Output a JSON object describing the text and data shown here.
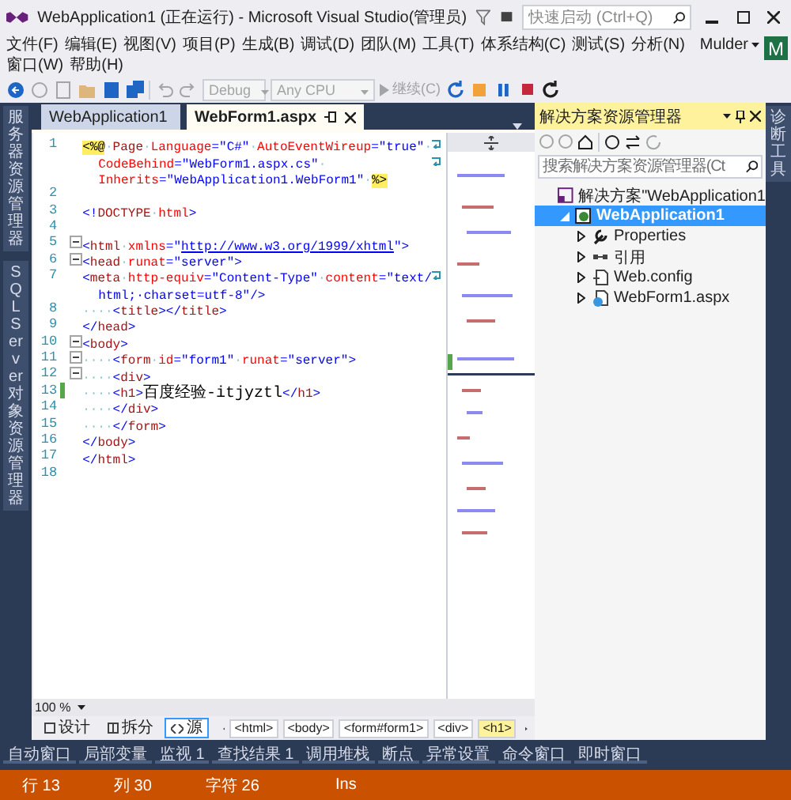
{
  "window": {
    "title": "WebApplication1 (正在运行) - Microsoft Visual Studio(管理员)"
  },
  "quick_launch": {
    "placeholder": "快速启动 (Ctrl+Q)"
  },
  "menu": {
    "rows": [
      [
        "文件(F)",
        "编辑(E)",
        "视图(V)",
        "项目(P)",
        "生成(B)",
        "调试(D)",
        "团队(M)",
        "工具(T)",
        "体系结构(C)",
        "测试(S)",
        "分析(N)"
      ],
      [
        "窗口(W)",
        "帮助(H)"
      ]
    ]
  },
  "account": {
    "name": "Mulder",
    "initial": "M"
  },
  "toolbar": {
    "config": {
      "value": "Debug",
      "disabled": true
    },
    "platform": {
      "value": "Any CPU",
      "disabled": true
    },
    "continue": "继续(C)"
  },
  "side_tabs_left": [
    "服务器资源管理器",
    "SQL Server 对象资源管理器"
  ],
  "side_tabs_right": [
    "诊断工具"
  ],
  "doc_tabs": [
    {
      "label": "WebApplication1",
      "selected": false
    },
    {
      "label": "WebForm1.aspx",
      "selected": true
    }
  ],
  "editor": {
    "lines": [
      {
        "number": "1",
        "fold": false,
        "changed": false,
        "rows": [
          "<%@·Page·Language=\"C#\"·AutoEventWireup=\"true\"·",
          "CodeBehind=\"WebForm1.aspx.cs\"·",
          "Inherits=\"WebApplication1.WebForm1\"·%>"
        ]
      },
      {
        "number": "2",
        "fold": false,
        "changed": false,
        "rows": [
          ""
        ]
      },
      {
        "number": "3",
        "fold": false,
        "changed": false,
        "rows": [
          "<!DOCTYPE·html>"
        ]
      },
      {
        "number": "4",
        "fold": false,
        "changed": false,
        "rows": [
          ""
        ]
      },
      {
        "number": "5",
        "fold": true,
        "changed": false,
        "rows": [
          "<html·xmlns=\"http://www.w3.org/1999/xhtml\">"
        ]
      },
      {
        "number": "6",
        "fold": true,
        "changed": false,
        "rows": [
          "<head·runat=\"server\">"
        ]
      },
      {
        "number": "7",
        "fold": false,
        "changed": false,
        "rows": [
          "<meta·http-equiv=\"Content-Type\"·content=\"text/",
          "html;·charset=utf-8\"/>"
        ]
      },
      {
        "number": "8",
        "fold": false,
        "changed": false,
        "rows": [
          "····<title></title>"
        ]
      },
      {
        "number": "9",
        "fold": false,
        "changed": false,
        "rows": [
          "</head>"
        ]
      },
      {
        "number": "10",
        "fold": true,
        "changed": false,
        "rows": [
          "<body>"
        ]
      },
      {
        "number": "11",
        "fold": true,
        "changed": false,
        "rows": [
          "····<form·id=\"form1\"·runat=\"server\">"
        ]
      },
      {
        "number": "12",
        "fold": true,
        "changed": false,
        "rows": [
          "····<div>"
        ]
      },
      {
        "number": "13",
        "fold": false,
        "changed": true,
        "rows": [
          "····<h1>百度经验-itjyztl</h1>"
        ]
      },
      {
        "number": "14",
        "fold": false,
        "changed": false,
        "rows": [
          "····</div>"
        ]
      },
      {
        "number": "15",
        "fold": false,
        "changed": false,
        "rows": [
          "····</form>"
        ]
      },
      {
        "number": "16",
        "fold": false,
        "changed": false,
        "rows": [
          "</body>"
        ]
      },
      {
        "number": "17",
        "fold": false,
        "changed": false,
        "rows": [
          "</html>"
        ]
      },
      {
        "number": "18",
        "fold": false,
        "changed": false,
        "rows": [
          ""
        ]
      }
    ]
  },
  "solution_explorer": {
    "title": "解决方案资源管理器",
    "search": {
      "placeholder": "搜索解决方案资源管理器(Ct"
    },
    "tree": [
      {
        "label": "解决方案\"WebApplication1",
        "kind": "solution",
        "selected": false,
        "children": [
          {
            "label": "WebApplication1",
            "kind": "project",
            "selected": true,
            "expanded": true,
            "children": [
              {
                "label": "Properties",
                "kind": "properties",
                "selected": false,
                "expanded": false
              },
              {
                "label": "引用",
                "kind": "references",
                "selected": false,
                "expanded": false
              },
              {
                "label": "Web.config",
                "kind": "config",
                "selected": false,
                "expanded": false
              },
              {
                "label": "WebForm1.aspx",
                "kind": "page",
                "selected": false,
                "expanded": false
              }
            ]
          }
        ]
      }
    ]
  },
  "bottom": {
    "zoom": "100 %",
    "views": [
      {
        "label": "设计",
        "kind": "design",
        "selected": false
      },
      {
        "label": "拆分",
        "kind": "split",
        "selected": false
      },
      {
        "label": "源",
        "kind": "source",
        "selected": true
      }
    ],
    "breadcrumb": [
      {
        "label": "<html>",
        "selected": false
      },
      {
        "label": "<body>",
        "selected": false
      },
      {
        "label": "<form#form1>",
        "selected": false
      },
      {
        "label": "<div>",
        "selected": false
      },
      {
        "label": "<h1>",
        "selected": true
      }
    ]
  },
  "tool_tabs": [
    "自动窗口",
    "局部变量",
    "监视 1",
    "查找结果 1",
    "调用堆栈",
    "断点",
    "异常设置",
    "命令窗口",
    "即时窗口"
  ],
  "status_bar": [
    "行 13",
    "列 30",
    "字符 26",
    "Ins"
  ]
}
